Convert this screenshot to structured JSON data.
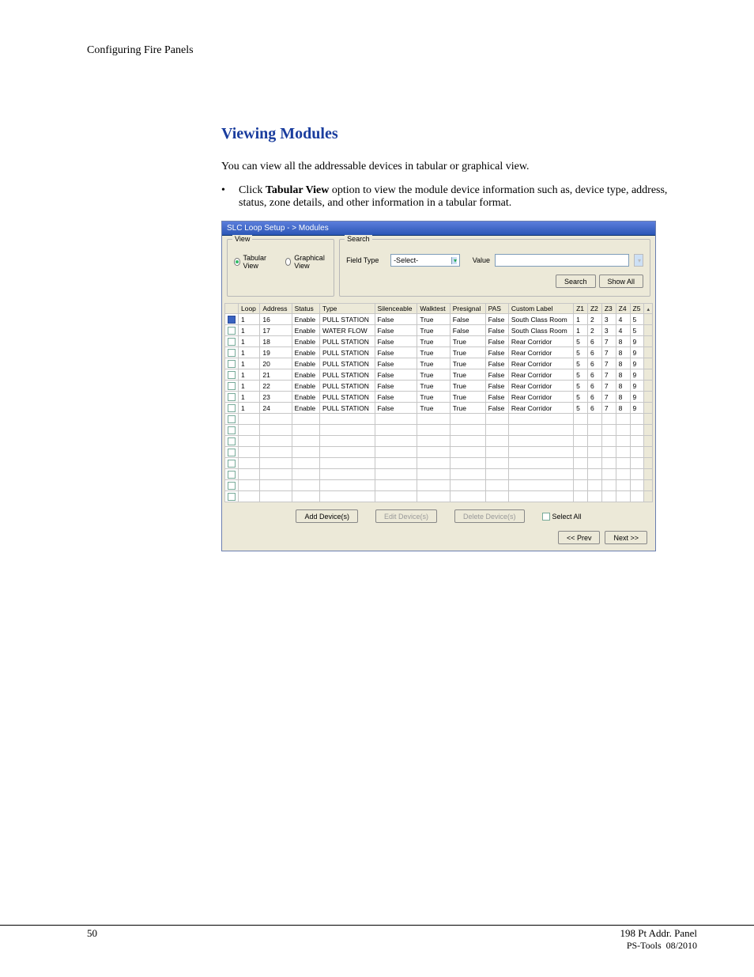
{
  "header": {
    "running": "Configuring Fire Panels"
  },
  "section": {
    "title": "Viewing Modules"
  },
  "intro": "You can view all the addressable devices in tabular or graphical view.",
  "bullet": {
    "dot": "•",
    "prefix": "Click ",
    "bold": "Tabular View",
    "suffix": " option to view the module device information such as, device type, address, status, zone details, and other information in a tabular format."
  },
  "shot": {
    "titlebar": "SLC Loop Setup - > Modules",
    "view": {
      "legend": "View",
      "tabular": "Tabular View",
      "graphical": "Graphical View"
    },
    "search": {
      "legend": "Search",
      "fieldtype_label": "Field Type",
      "fieldtype_value": "-Select-",
      "value_label": "Value",
      "value_placeholder": "",
      "value_disabled": "",
      "search_btn": "Search",
      "showall_btn": "Show All"
    },
    "columns": [
      "",
      "Loop",
      "Address",
      "Status",
      "Type",
      "Silenceable",
      "Walktest",
      "Presignal",
      "PAS",
      "Custom Label",
      "Z1",
      "Z2",
      "Z3",
      "Z4",
      "Z5",
      ""
    ],
    "rows": [
      {
        "cb": true,
        "loop": "1",
        "addr": "16",
        "status": "Enable",
        "type": "PULL STATION",
        "sil": "False",
        "walk": "True",
        "pre": "False",
        "pas": "False",
        "label": "South Class Room",
        "z": [
          "1",
          "2",
          "3",
          "4",
          "5"
        ]
      },
      {
        "cb": false,
        "loop": "1",
        "addr": "17",
        "status": "Enable",
        "type": "WATER FLOW",
        "sil": "False",
        "walk": "True",
        "pre": "False",
        "pas": "False",
        "label": "South Class Room",
        "z": [
          "1",
          "2",
          "3",
          "4",
          "5"
        ]
      },
      {
        "cb": false,
        "loop": "1",
        "addr": "18",
        "status": "Enable",
        "type": "PULL STATION",
        "sil": "False",
        "walk": "True",
        "pre": "True",
        "pas": "False",
        "label": "Rear Corridor",
        "z": [
          "5",
          "6",
          "7",
          "8",
          "9"
        ]
      },
      {
        "cb": false,
        "loop": "1",
        "addr": "19",
        "status": "Enable",
        "type": "PULL STATION",
        "sil": "False",
        "walk": "True",
        "pre": "True",
        "pas": "False",
        "label": "Rear Corridor",
        "z": [
          "5",
          "6",
          "7",
          "8",
          "9"
        ]
      },
      {
        "cb": false,
        "loop": "1",
        "addr": "20",
        "status": "Enable",
        "type": "PULL STATION",
        "sil": "False",
        "walk": "True",
        "pre": "True",
        "pas": "False",
        "label": "Rear Corridor",
        "z": [
          "5",
          "6",
          "7",
          "8",
          "9"
        ]
      },
      {
        "cb": false,
        "loop": "1",
        "addr": "21",
        "status": "Enable",
        "type": "PULL STATION",
        "sil": "False",
        "walk": "True",
        "pre": "True",
        "pas": "False",
        "label": "Rear Corridor",
        "z": [
          "5",
          "6",
          "7",
          "8",
          "9"
        ]
      },
      {
        "cb": false,
        "loop": "1",
        "addr": "22",
        "status": "Enable",
        "type": "PULL STATION",
        "sil": "False",
        "walk": "True",
        "pre": "True",
        "pas": "False",
        "label": "Rear Corridor",
        "z": [
          "5",
          "6",
          "7",
          "8",
          "9"
        ]
      },
      {
        "cb": false,
        "loop": "1",
        "addr": "23",
        "status": "Enable",
        "type": "PULL STATION",
        "sil": "False",
        "walk": "True",
        "pre": "True",
        "pas": "False",
        "label": "Rear Corridor",
        "z": [
          "5",
          "6",
          "7",
          "8",
          "9"
        ]
      },
      {
        "cb": false,
        "loop": "1",
        "addr": "24",
        "status": "Enable",
        "type": "PULL STATION",
        "sil": "False",
        "walk": "True",
        "pre": "True",
        "pas": "False",
        "label": "Rear Corridor",
        "z": [
          "5",
          "6",
          "7",
          "8",
          "9"
        ]
      }
    ],
    "empty_rows": 8,
    "bottom": {
      "add": "Add Device(s)",
      "edit": "Edit Device(s)",
      "del": "Delete Device(s)",
      "selall": "Select All"
    },
    "nav": {
      "prev": "<< Prev",
      "next": "Next >>"
    }
  },
  "footer": {
    "page": "50",
    "product": "198 Pt Addr. Panel",
    "sub": "PS-Tools  08/2010"
  }
}
